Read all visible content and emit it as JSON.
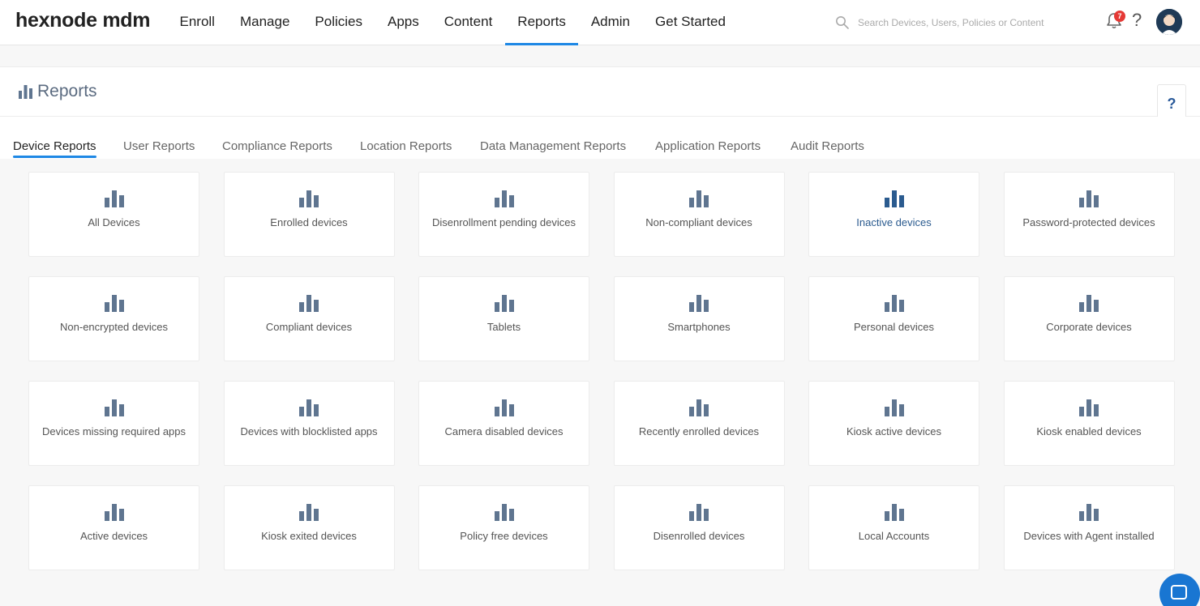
{
  "app": {
    "logo": "hexnode mdm"
  },
  "nav": {
    "items": [
      "Enroll",
      "Manage",
      "Policies",
      "Apps",
      "Content",
      "Reports",
      "Admin",
      "Get Started"
    ],
    "active": "Reports"
  },
  "search": {
    "placeholder": "Search Devices, Users, Policies or Content"
  },
  "notifications": {
    "count": "7"
  },
  "help": {
    "symbol": "?"
  },
  "page": {
    "title": "Reports"
  },
  "tabs": [
    {
      "label": "Device Reports",
      "active": true
    },
    {
      "label": "User Reports"
    },
    {
      "label": "Compliance Reports"
    },
    {
      "label": "Location Reports"
    },
    {
      "label": "Data Management Reports"
    },
    {
      "label": "Application Reports"
    },
    {
      "label": "Audit Reports"
    }
  ],
  "reports": [
    "All Devices",
    "Enrolled devices",
    "Disenrollment pending devices",
    "Non-compliant devices",
    "Inactive devices",
    "Password-protected devices",
    "Non-encrypted devices",
    "Compliant devices",
    "Tablets",
    "Smartphones",
    "Personal devices",
    "Corporate devices",
    "Devices missing required apps",
    "Devices with blocklisted apps",
    "Camera disabled devices",
    "Recently enrolled devices",
    "Kiosk active devices",
    "Kiosk enabled devices",
    "Active devices",
    "Kiosk exited devices",
    "Policy free devices",
    "Disenrolled devices",
    "Local Accounts",
    "Devices with Agent installed"
  ],
  "highlighted_report": "Inactive devices",
  "colors": {
    "accent": "#1e88e5",
    "icon": "#5f7590",
    "icon_highlight": "#2b5b8f",
    "badge": "#e53935"
  }
}
